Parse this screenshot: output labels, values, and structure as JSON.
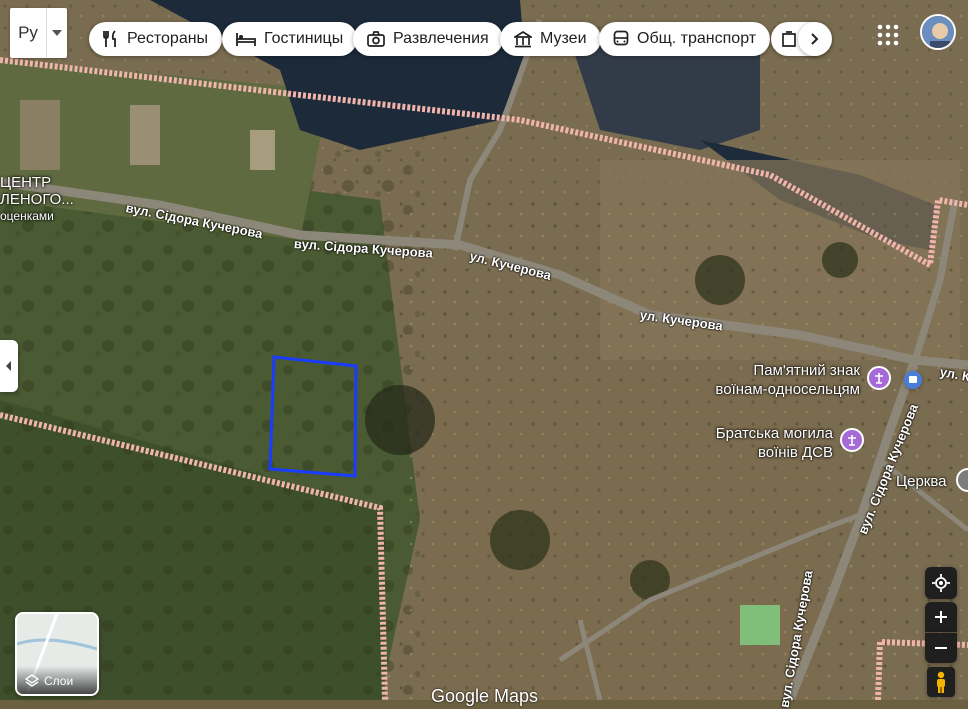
{
  "language": {
    "code": "Ру"
  },
  "categories": [
    {
      "label": "Рестораны",
      "icon": "fork-knife-icon"
    },
    {
      "label": "Гостиницы",
      "icon": "bed-icon"
    },
    {
      "label": "Развлечения",
      "icon": "camera-icon"
    },
    {
      "label": "Музеи",
      "icon": "museum-icon"
    },
    {
      "label": "Общ. транспорт",
      "icon": "bus-icon"
    }
  ],
  "roads": [
    "вул. Сідора Кучерова",
    "вул. Сідора Кучерова",
    "ул. Кучерова",
    "ул. Кучерова",
    "вул. Сідора Кучерова",
    "ул. К",
    "вул. Сідора Кучерова"
  ],
  "places": {
    "center_partial": [
      "ЦЕНТР",
      "ЛЕНОГО...",
      "оценками"
    ],
    "memorial": [
      "Пам'ятний знак",
      "воїнам-односельцям"
    ],
    "grave": [
      "Братська могила",
      "воїнів ДСВ"
    ],
    "church": "Церква"
  },
  "layers": {
    "label": "Слои"
  },
  "watermark": "Google Maps",
  "colors": {
    "boundary": "#f1b4ab",
    "selection": "#1a3cff",
    "poi": "#a56ad6"
  }
}
